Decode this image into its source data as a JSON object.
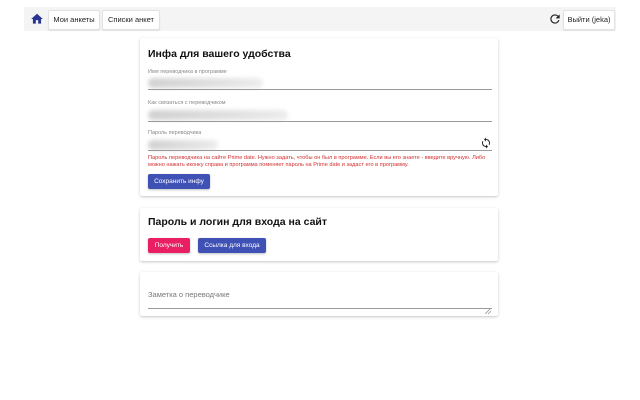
{
  "topbar": {
    "home_icon": "home-icon",
    "my_profiles": "Мои анкеты",
    "profile_lists": "Списки анкет",
    "refresh_icon": "refresh-icon",
    "logout": "Выйти (jeka)"
  },
  "info_card": {
    "title": "Инфа для вашего удобства",
    "translator_name_label": "Имя переводчика в программе",
    "contact_label": "Как связаться с переводчиком",
    "password_label": "Пароль переводчика",
    "regenerate_icon": "sync-icon",
    "warning": "Пароль переводчика на сайте Prime date. Нужно задать, чтобы он был в программе. Если вы его знаете - введите вручную. Либо можно нажать иконку справа и программа поменяет пароль на Prime date и задаст его в программу.",
    "save_button": "Сохранить инфу"
  },
  "login_card": {
    "title": "Пароль и логин для входа на сайт",
    "get_button": "Получить",
    "login_link_button": "Ссылка для входа"
  },
  "note_card": {
    "placeholder": "Заметка о переводчике"
  },
  "colors": {
    "primary": "#3f51b5",
    "secondary": "#e91e63",
    "warning_text": "#d32f2f"
  }
}
